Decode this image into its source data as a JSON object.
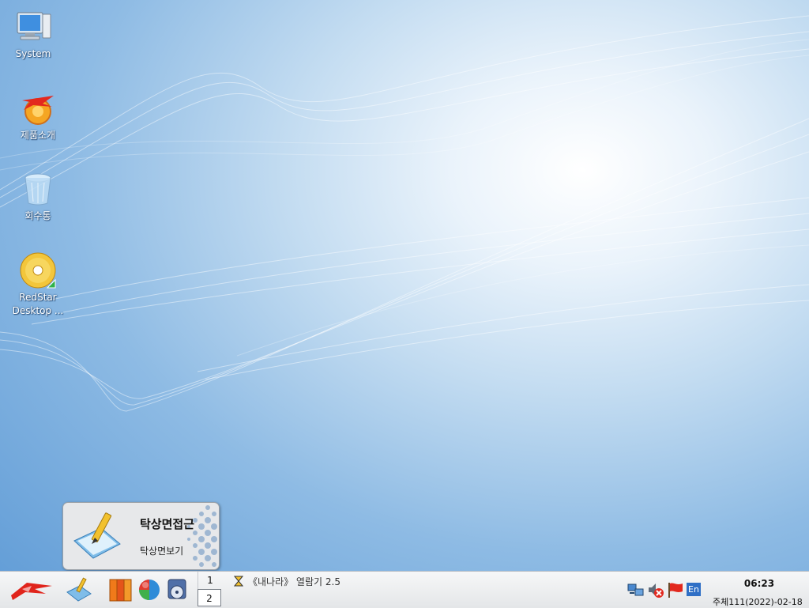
{
  "desktop": {
    "icons": [
      {
        "label": "System"
      },
      {
        "label": "제품소개"
      },
      {
        "label": "회수통"
      },
      {
        "label": "RedStar Desktop ..."
      }
    ]
  },
  "tooltip": {
    "title": "탁상면접근",
    "subtitle": "탁상면보기"
  },
  "taskbar": {
    "pager": [
      "1",
      "2"
    ],
    "task_label": "《내나라》 열람기 2.5",
    "clock_time": "06:23",
    "clock_date": "주체111(2022)-02-18",
    "tray_lang": "En"
  }
}
